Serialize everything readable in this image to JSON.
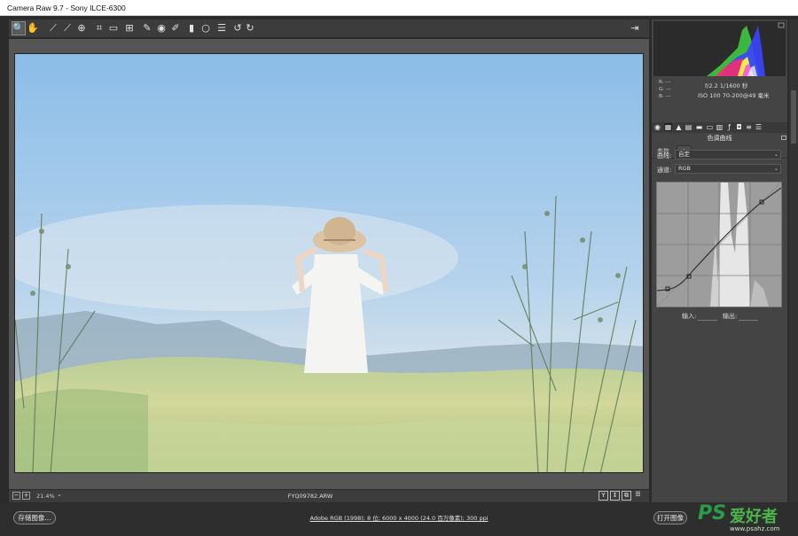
{
  "window": {
    "title": "Camera Raw 9.7  -  Sony ILCE-6300"
  },
  "toolbar": {
    "tools": [
      {
        "name": "zoom-tool",
        "glyph": "🔍"
      },
      {
        "name": "hand-tool",
        "glyph": "✋"
      },
      {
        "name": "white-balance-tool",
        "glyph": "⟋"
      },
      {
        "name": "color-sampler-tool",
        "glyph": "⟋"
      },
      {
        "name": "targeted-adjustment-tool",
        "glyph": "⊕"
      },
      {
        "name": "crop-tool",
        "glyph": "⌗"
      },
      {
        "name": "straighten-tool",
        "glyph": "▭"
      },
      {
        "name": "transform-tool",
        "glyph": "⊞"
      },
      {
        "name": "spot-removal-tool",
        "glyph": "✎"
      },
      {
        "name": "red-eye-removal-tool",
        "glyph": "◉"
      },
      {
        "name": "adjustment-brush-tool",
        "glyph": "✐"
      },
      {
        "name": "graduated-filter-tool",
        "glyph": "▮"
      },
      {
        "name": "radial-filter-tool",
        "glyph": "○"
      },
      {
        "name": "preferences-tool",
        "glyph": "☰"
      },
      {
        "name": "rotate-left-tool",
        "glyph": "↺"
      },
      {
        "name": "rotate-right-tool",
        "glyph": "↻"
      }
    ],
    "fullscreen_glyph": "⇥"
  },
  "status": {
    "zoom": "21.4%",
    "filename": "FYQ09782.ARW",
    "view_buttons": [
      "Y",
      "↕",
      "⧉",
      "☰"
    ]
  },
  "bottom": {
    "save_label": "存储图像...",
    "workflow_text": "Adobe RGB (1998); 8 位; 6000 x 4000 (24.0 百万像素); 300 ppi",
    "open_label": "打开图像"
  },
  "readout": {
    "r": "R:  ---",
    "g": "G:  ---",
    "b": "B:  ---",
    "aperture_shutter": "f/2.2   1/1600 秒",
    "iso_lens": "ISO 100   70-200@49 毫米"
  },
  "panel": {
    "title": "色调曲线",
    "tabs": [
      "参数",
      "点"
    ],
    "active_tab": "点",
    "curve_label": "曲线:",
    "curve_value": "自定",
    "channel_label": "通道:",
    "channel_value": "RGB",
    "input_label": "输入:",
    "output_label": "输出:"
  },
  "watermark": {
    "ps": "PS",
    "cn": "爱好者",
    "url": "www.psahz.com"
  }
}
